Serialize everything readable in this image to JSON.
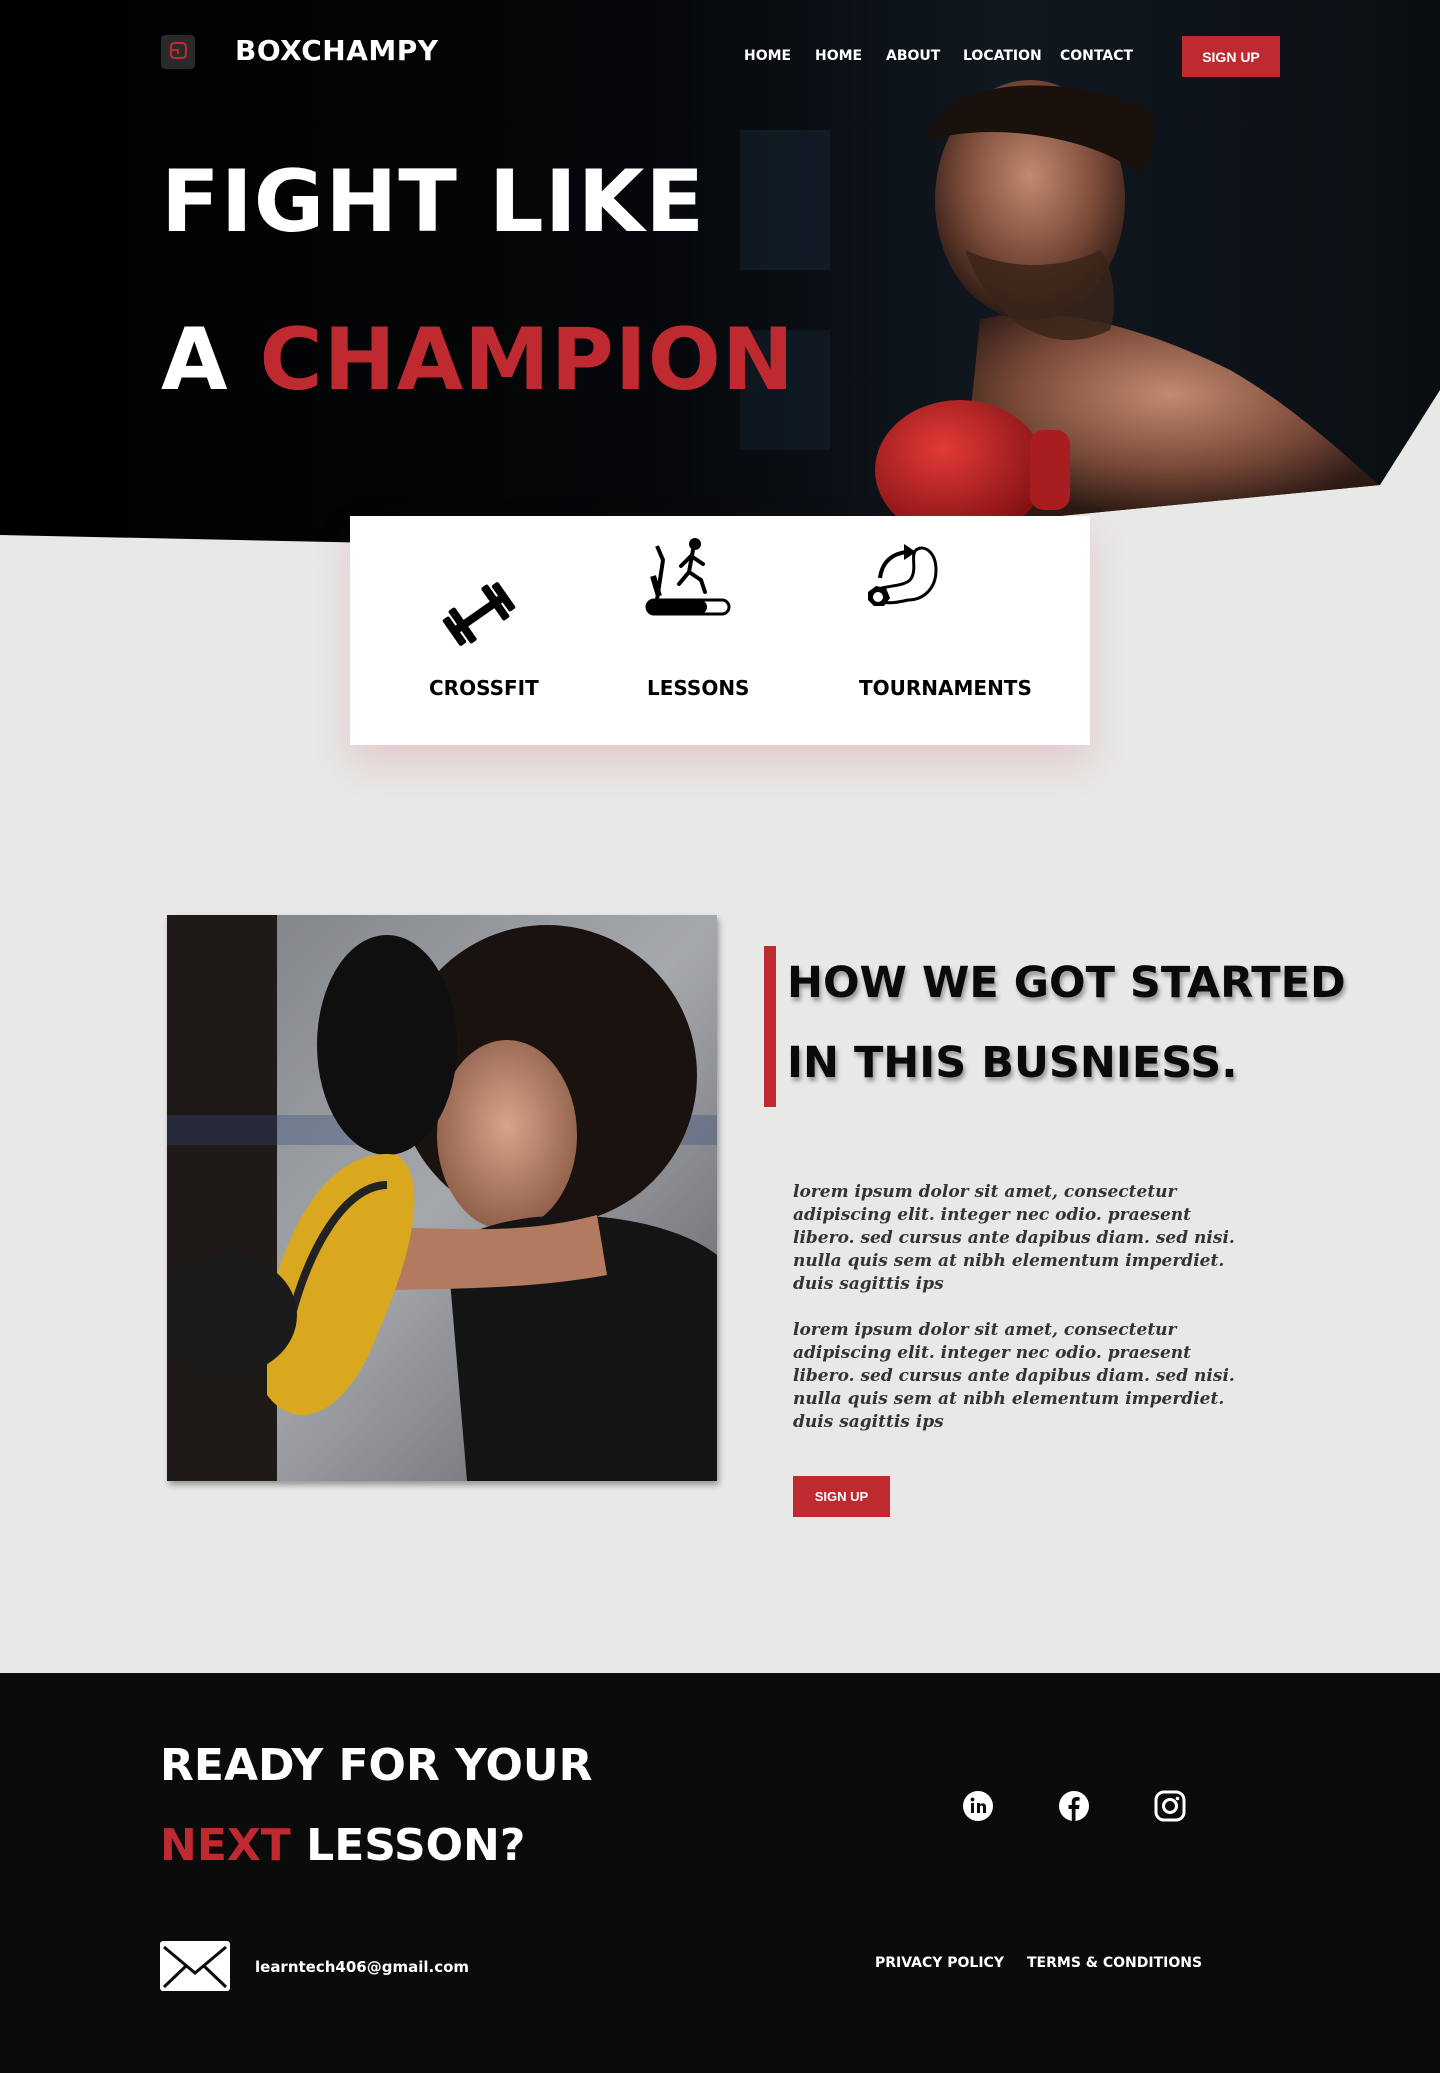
{
  "brand": {
    "name": "BOXCHAMPY",
    "logo_icon": "boxing-glove-icon"
  },
  "nav": {
    "items": [
      {
        "label": "HOME"
      },
      {
        "label": "HOME"
      },
      {
        "label": "ABOUT"
      },
      {
        "label": "LOCATION"
      },
      {
        "label": "CONTACT"
      }
    ],
    "signup_label": "SIGN UP"
  },
  "hero": {
    "line1": "FIGHT LIKE",
    "line2_prefix": "A",
    "line2_highlight": "CHAMPION"
  },
  "services": [
    {
      "label": "CROSSFIT",
      "icon": "dumbbell-icon"
    },
    {
      "label": "LESSONS",
      "icon": "treadmill-icon"
    },
    {
      "label": "TOURNAMENTS",
      "icon": "flexed-arm-icon"
    }
  ],
  "about": {
    "title_line1": "HOW WE GOT STARTED",
    "title_line2": "IN THIS BUSNIESS.",
    "paragraph1": "lorem ipsum dolor sit amet, consectetur adipiscing elit. integer nec odio. praesent libero. sed cursus ante dapibus diam. sed nisi. nulla quis sem at nibh elementum imperdiet. duis sagittis ips",
    "paragraph2": "lorem ipsum dolor sit amet, consectetur adipiscing elit. integer nec odio. praesent libero. sed cursus ante dapibus diam. sed nisi. nulla quis sem at nibh elementum imperdiet. duis sagittis ips",
    "signup_label": "SIGN UP"
  },
  "footer": {
    "cta_line1": "READY FOR YOUR",
    "cta_line2_highlight": "NEXT",
    "cta_line2_rest": "LESSON?",
    "social": [
      "linkedin-icon",
      "facebook-icon",
      "instagram-icon"
    ],
    "email": "learntech406@gmail.com",
    "privacy_label": "PRIVACY POLICY",
    "terms_label": "TERMS & CONDITIONS"
  },
  "colors": {
    "accent": "#be2a30",
    "dark": "#0b0b0b",
    "page_bg": "#e8e8e6"
  }
}
